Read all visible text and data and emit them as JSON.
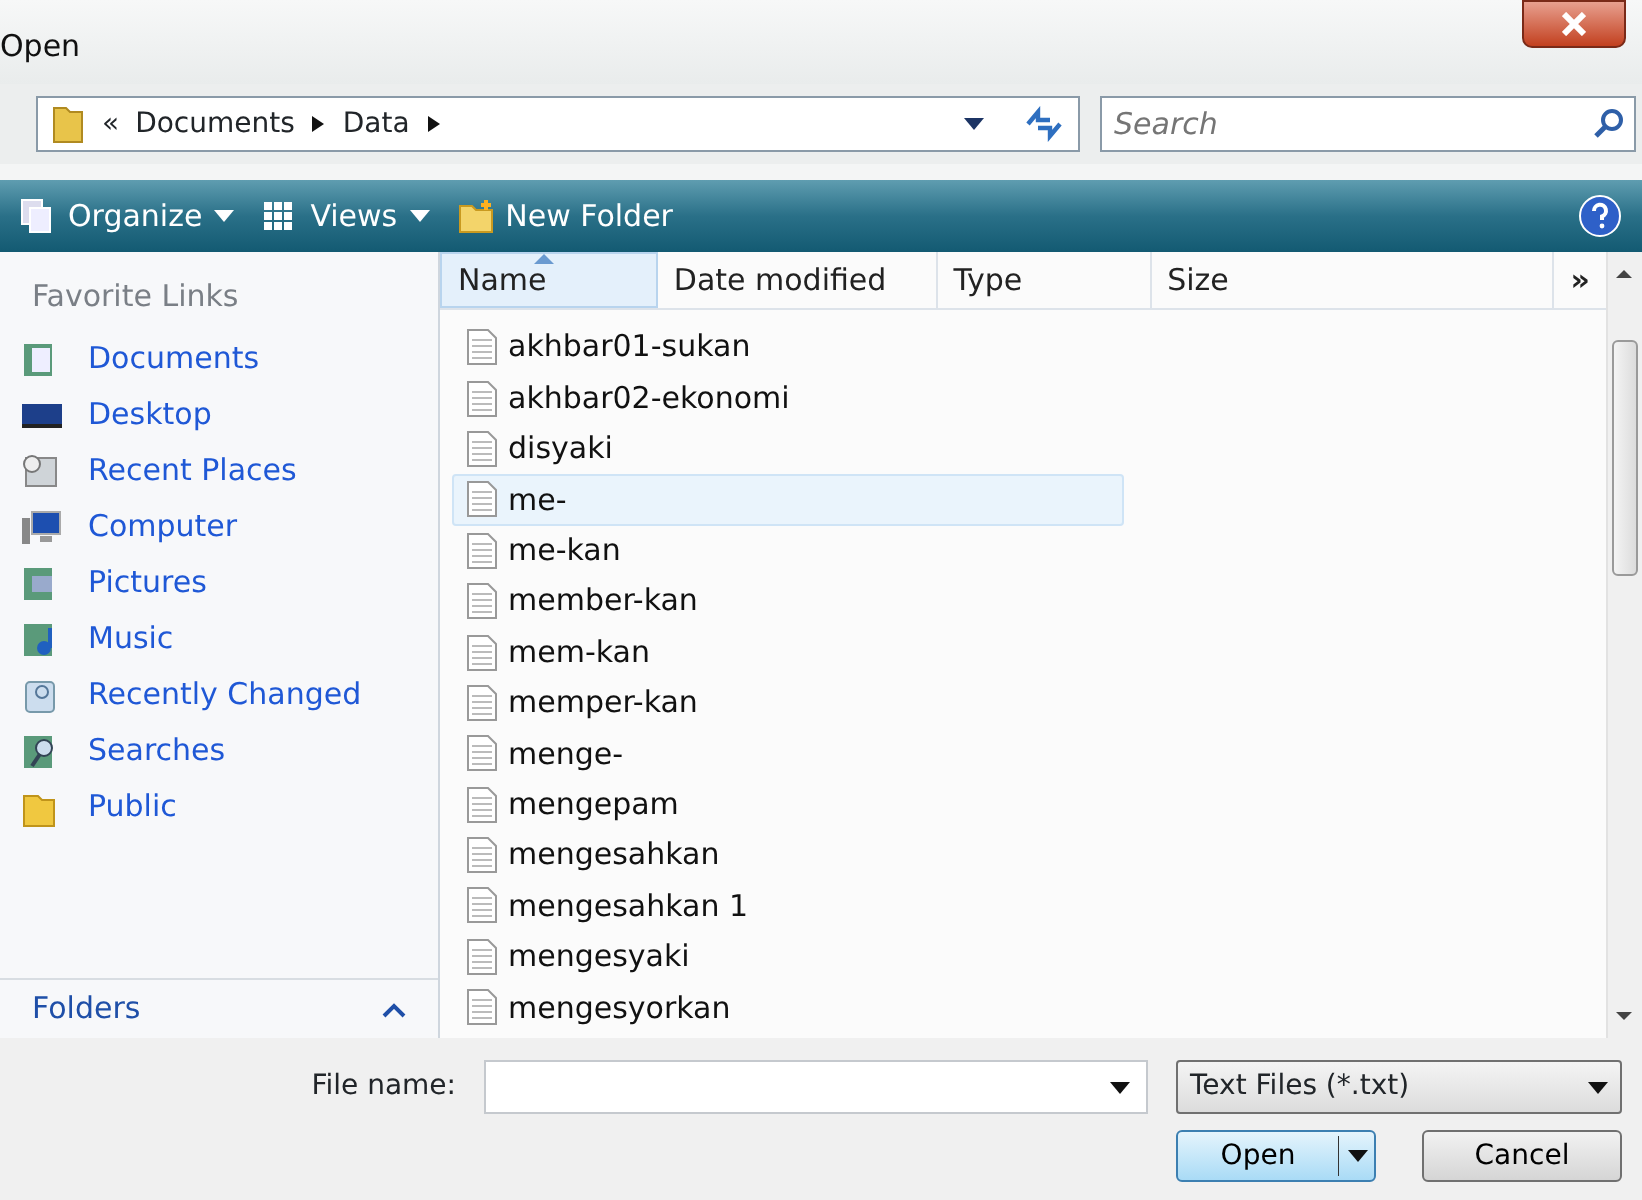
{
  "window": {
    "title": "Open"
  },
  "address": {
    "crumbs": [
      "«",
      "Documents",
      "Data"
    ]
  },
  "search": {
    "placeholder": "Search"
  },
  "toolbar": [
    {
      "label": "Organize",
      "kind": "organize"
    },
    {
      "label": "Views",
      "kind": "views"
    },
    {
      "label": "New Folder",
      "kind": "folder"
    }
  ],
  "sidebar": {
    "heading": "Favorite Links",
    "items": [
      {
        "label": "Documents",
        "kind": "documents"
      },
      {
        "label": "Desktop",
        "kind": "desktop"
      },
      {
        "label": "Recent Places",
        "kind": "recent"
      },
      {
        "label": "Computer",
        "kind": "computer"
      },
      {
        "label": "Pictures",
        "kind": "pictures"
      },
      {
        "label": "Music",
        "kind": "music"
      },
      {
        "label": "Recently Changed",
        "kind": "changed"
      },
      {
        "label": "Searches",
        "kind": "searches"
      },
      {
        "label": "Public",
        "kind": "public"
      }
    ],
    "folders": "Folders"
  },
  "table": {
    "columns": [
      {
        "label": "Name",
        "sorted": true
      },
      {
        "label": "Date modified",
        "sorted": false
      },
      {
        "label": "Type",
        "sorted": false
      },
      {
        "label": "Size",
        "sorted": false
      }
    ],
    "more": "»",
    "rows": [
      {
        "name": "akhbar01-sukan",
        "selected": false
      },
      {
        "name": "akhbar02-ekonomi",
        "selected": false
      },
      {
        "name": "disyaki",
        "selected": false
      },
      {
        "name": "me-",
        "selected": true
      },
      {
        "name": "me-kan",
        "selected": false
      },
      {
        "name": "member-kan",
        "selected": false
      },
      {
        "name": "mem-kan",
        "selected": false
      },
      {
        "name": "memper-kan",
        "selected": false
      },
      {
        "name": "menge-",
        "selected": false
      },
      {
        "name": "mengepam",
        "selected": false
      },
      {
        "name": "mengesahkan",
        "selected": false
      },
      {
        "name": "mengesahkan 1",
        "selected": false
      },
      {
        "name": "mengesyaki",
        "selected": false
      },
      {
        "name": "mengesyorkan",
        "selected": false
      }
    ]
  },
  "file_name": {
    "label": "File name:"
  },
  "file_type": {
    "value": "Text Files (*.txt)"
  },
  "buttons": [
    {
      "label": "Open",
      "kind": "split"
    },
    {
      "label": "Cancel",
      "kind": "plain"
    }
  ]
}
